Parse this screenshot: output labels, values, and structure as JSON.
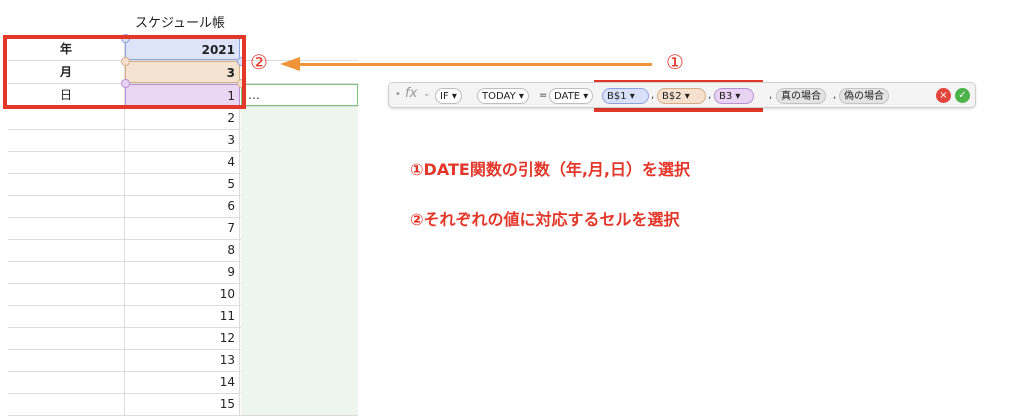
{
  "sheet": {
    "title": "スケジュール帳",
    "rows": [
      {
        "label": "年",
        "value": "2021"
      },
      {
        "label": "月",
        "value": "3"
      },
      {
        "label": "日",
        "value": "1",
        "extra": "…"
      },
      {
        "label": "",
        "value": "2"
      },
      {
        "label": "",
        "value": "3"
      },
      {
        "label": "",
        "value": "4"
      },
      {
        "label": "",
        "value": "5"
      },
      {
        "label": "",
        "value": "6"
      },
      {
        "label": "",
        "value": "7"
      },
      {
        "label": "",
        "value": "8"
      },
      {
        "label": "",
        "value": "9"
      },
      {
        "label": "",
        "value": "10"
      },
      {
        "label": "",
        "value": "11"
      },
      {
        "label": "",
        "value": "12"
      },
      {
        "label": "",
        "value": "13"
      },
      {
        "label": "",
        "value": "14"
      },
      {
        "label": "",
        "value": "15"
      },
      {
        "label": "",
        "value": ""
      }
    ]
  },
  "annotations": {
    "marker_one": "①",
    "marker_two": "②",
    "note_one": "①DATE関数の引数（年,月,日）を選択",
    "note_two": "②それぞれの値に対応するセルを選択"
  },
  "formula_bar": {
    "fx_label": "fx",
    "tokens": {
      "if": "IF ▾",
      "today": "TODAY ▾",
      "equals": "=",
      "date": "DATE ▾",
      "ref_year": "B$1 ▾",
      "ref_month": "B$2 ▾",
      "ref_day": "B3 ▾",
      "comma": ",",
      "true_case": "真の場合",
      "false_case": "偽の場合"
    },
    "cancel_icon": "×",
    "accept_icon": "✓"
  },
  "colors": {
    "highlight_red": "#e3372a",
    "arrow_orange": "#f0943a",
    "year_ref": "#d9e1fa",
    "month_ref": "#f5e1cd",
    "day_ref": "#e8d3f3",
    "cancel": "#e2453c",
    "accept": "#4cb34a"
  }
}
